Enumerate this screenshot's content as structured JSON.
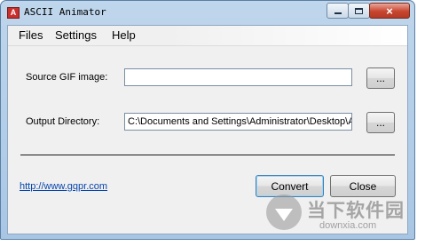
{
  "window": {
    "title": "ASCII Animator",
    "close_glyph": "×"
  },
  "menu": {
    "files": "Files",
    "settings": "Settings",
    "help": "Help"
  },
  "form": {
    "source_label": "Source GIF image:",
    "source_value": "",
    "output_label": "Output Directory:",
    "output_value": "C:\\Documents and Settings\\Administrator\\Desktop\\A",
    "browse_label": "..."
  },
  "footer": {
    "link": "http://www.gqpr.com",
    "convert": "Convert",
    "close": "Close"
  },
  "watermark": {
    "text": "当下软件园",
    "sub": "downxia.com"
  },
  "colors": {
    "titlebar": "#bfd6ec",
    "close_button": "#c8452f",
    "link": "#0645ad",
    "convert_border": "#3c7fb1"
  }
}
